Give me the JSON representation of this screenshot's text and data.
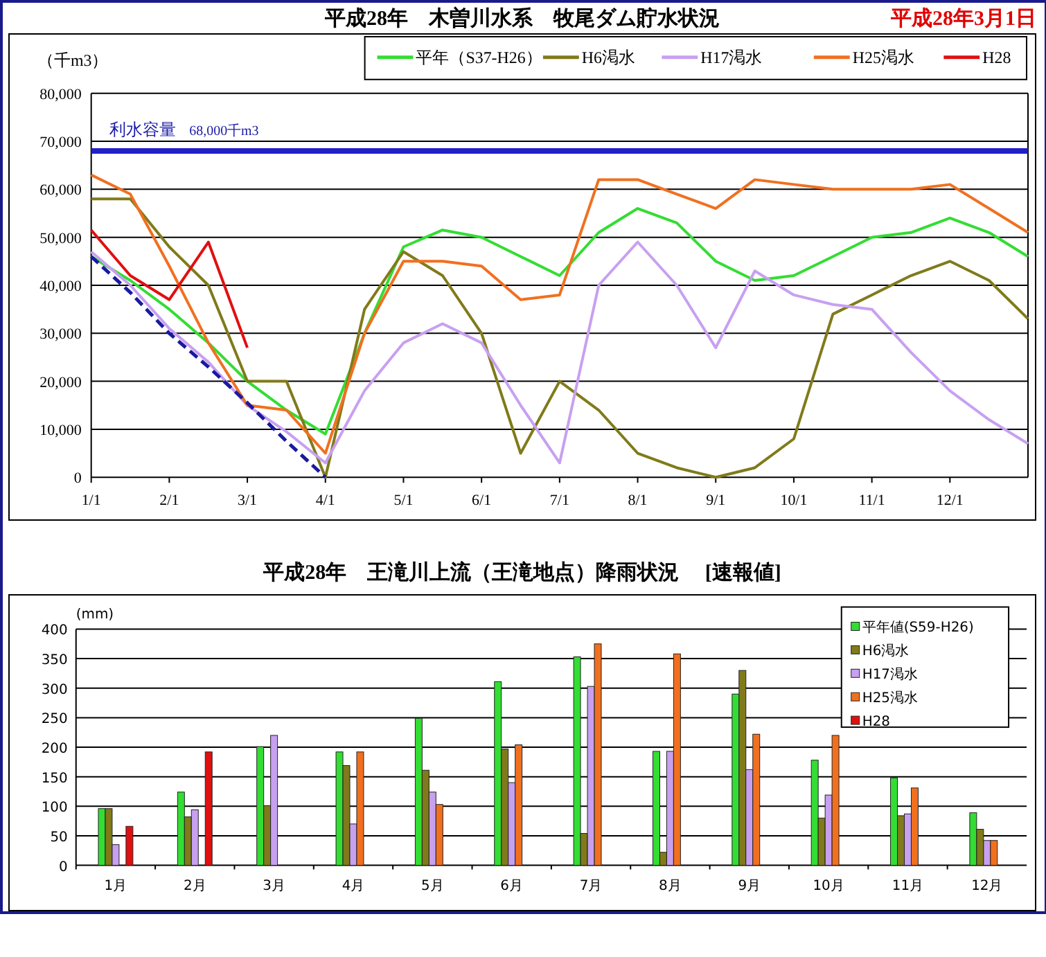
{
  "header": {
    "title": "平成28年　木曽川水系　牧尾ダム貯水状況",
    "date": "平成28年3月1日"
  },
  "storage_chart": {
    "unit": "（千m3）",
    "chart_data": {
      "type": "line",
      "categories": [
        "1/1",
        null,
        "2/1",
        null,
        "3/1",
        null,
        "4/1",
        null,
        "5/1",
        null,
        "6/1",
        null,
        "7/1",
        null,
        "8/1",
        null,
        "9/1",
        null,
        "10/1",
        null,
        "11/1",
        null,
        "12/1",
        null,
        null
      ],
      "ylim": [
        0,
        80000
      ],
      "yticks": [
        {
          "value": 0,
          "label": "0"
        },
        {
          "value": 10000,
          "label": "10,000"
        },
        {
          "value": 20000,
          "label": "20,000"
        },
        {
          "value": 30000,
          "label": "30,000"
        },
        {
          "value": 40000,
          "label": "40,000"
        },
        {
          "value": 50000,
          "label": "50,000"
        },
        {
          "value": 60000,
          "label": "60,000"
        },
        {
          "value": 70000,
          "label": "70,000"
        },
        {
          "value": 80000,
          "label": "80,000"
        }
      ],
      "series": [
        {
          "name": "平年（S37-H26）",
          "color": "#33dd33",
          "values": [
            46000,
            41000,
            35000,
            28000,
            20000,
            14000,
            9000,
            30000,
            48000,
            51500,
            50000,
            46000,
            42000,
            51000,
            56000,
            53000,
            45000,
            41000,
            42000,
            46000,
            50000,
            51000,
            54000,
            51000,
            46000
          ]
        },
        {
          "name": "H6渇水",
          "color": "#807a1a",
          "values": [
            58000,
            58000,
            48000,
            40000,
            20000,
            20000,
            0,
            35000,
            47000,
            42000,
            30000,
            5000,
            20000,
            14000,
            5000,
            2000,
            0,
            2000,
            8000,
            34000,
            38000,
            42000,
            45000,
            41000,
            33000
          ]
        },
        {
          "name": "H17渇水",
          "color": "#c8a0f0",
          "values": [
            47000,
            40000,
            31000,
            24000,
            15000,
            9500,
            3000,
            18000,
            28000,
            32000,
            28000,
            15000,
            3000,
            40000,
            49000,
            40000,
            27000,
            43000,
            38000,
            36000,
            35000,
            26000,
            18000,
            12000,
            7000
          ]
        },
        {
          "name": "H25渇水",
          "color": "#f07020",
          "values": [
            63000,
            59000,
            44000,
            28000,
            15000,
            14000,
            5000,
            30000,
            45000,
            45000,
            44000,
            37000,
            38000,
            62000,
            62000,
            59000,
            56000,
            62000,
            61000,
            60000,
            60000,
            60000,
            61000,
            56000,
            51000
          ]
        },
        {
          "name": "H28",
          "color": "#e01010",
          "values": [
            51500,
            42000,
            37000,
            49000,
            27000,
            null,
            null,
            null,
            null,
            null,
            null,
            null,
            null,
            null,
            null,
            null,
            null,
            null,
            null,
            null,
            null,
            null,
            null,
            null,
            null
          ]
        },
        {
          "color": "#1a1aa0",
          "line_style": "dashed",
          "values": [
            46000,
            38500,
            30000,
            23000,
            15500,
            7500,
            0,
            null,
            null,
            null,
            null,
            null,
            null,
            null,
            null,
            null,
            null,
            null,
            null,
            null,
            null,
            null,
            null,
            null,
            null
          ]
        }
      ],
      "grid": true,
      "legend": true,
      "ref_lines": [
        {
          "axis": "y",
          "value": 68000
        }
      ],
      "annotations": [
        "利水容量",
        "68,000千m3"
      ]
    }
  },
  "rain_chart": {
    "title": "平成28年　王滝川上流（王滝地点）降雨状況　 [速報値]",
    "unit": "(mm)",
    "chart_data": {
      "type": "bar",
      "categories": [
        "1月",
        "2月",
        "3月",
        "4月",
        "5月",
        "6月",
        "7月",
        "8月",
        "9月",
        "10月",
        "11月",
        "12月"
      ],
      "ylim": [
        0,
        400
      ],
      "yticks": [
        0,
        50,
        100,
        150,
        200,
        250,
        300,
        350,
        400
      ],
      "grid": true,
      "legend": true,
      "series": [
        {
          "name": "平年値(S59-H26)",
          "color": "#33dd33",
          "values": [
            96,
            124,
            201,
            192,
            249,
            311,
            353,
            193,
            290,
            178,
            148,
            89
          ]
        },
        {
          "name": "H6渇水",
          "color": "#807a1a",
          "values": [
            96,
            82,
            101,
            169,
            161,
            197,
            54,
            22,
            330,
            80,
            84,
            61
          ]
        },
        {
          "name": "H17渇水",
          "color": "#c8a0f0",
          "values": [
            35,
            94,
            220,
            70,
            124,
            140,
            303,
            193,
            162,
            119,
            87,
            42
          ]
        },
        {
          "name": "H25渇水",
          "color": "#f07020",
          "values": [
            null,
            null,
            null,
            192,
            103,
            204,
            375,
            358,
            222,
            220,
            131,
            42
          ]
        },
        {
          "name": "H28",
          "color": "#e01010",
          "values": [
            66,
            192,
            null,
            null,
            null,
            null,
            null,
            null,
            null,
            null,
            null,
            null
          ]
        }
      ]
    }
  }
}
